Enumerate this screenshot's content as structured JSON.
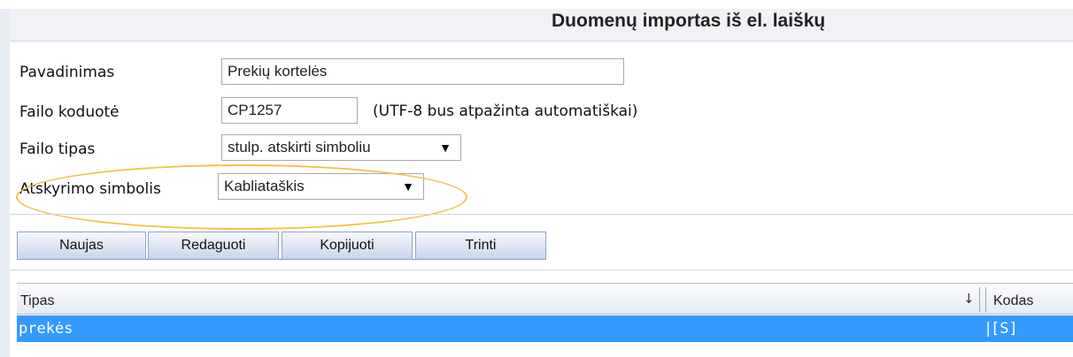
{
  "header": {
    "title": "Duomenų importas iš el. laiškų"
  },
  "form": {
    "name_label": "Pavadinimas",
    "name_value": "Prekių kortelės",
    "encoding_label": "Failo koduotė",
    "encoding_value": "CP1257",
    "encoding_hint": "(UTF-8 bus atpažinta automatiškai)",
    "filetype_label": "Failo tipas",
    "filetype_value": "stulp. atskirti simboliu",
    "separator_label": "Atskyrimo simbolis",
    "separator_value": "Kabliataškis"
  },
  "toolbar": {
    "new_label": "Naujas",
    "edit_label": "Redaguoti",
    "copy_label": "Kopijuoti",
    "delete_label": "Trinti"
  },
  "grid": {
    "columns": [
      "Tipas",
      "Kodas"
    ],
    "sort_indicator": "↓",
    "rows": [
      {
        "tipas": "prekės",
        "kodas": "[S]"
      }
    ]
  },
  "icons": {
    "dropdown": "triangle-down-icon",
    "sort": "sort-down-icon"
  },
  "colors": {
    "selection": "#3399ff",
    "highlight_ellipse": "#f2c24a",
    "button_border": "#8aa2c8"
  }
}
